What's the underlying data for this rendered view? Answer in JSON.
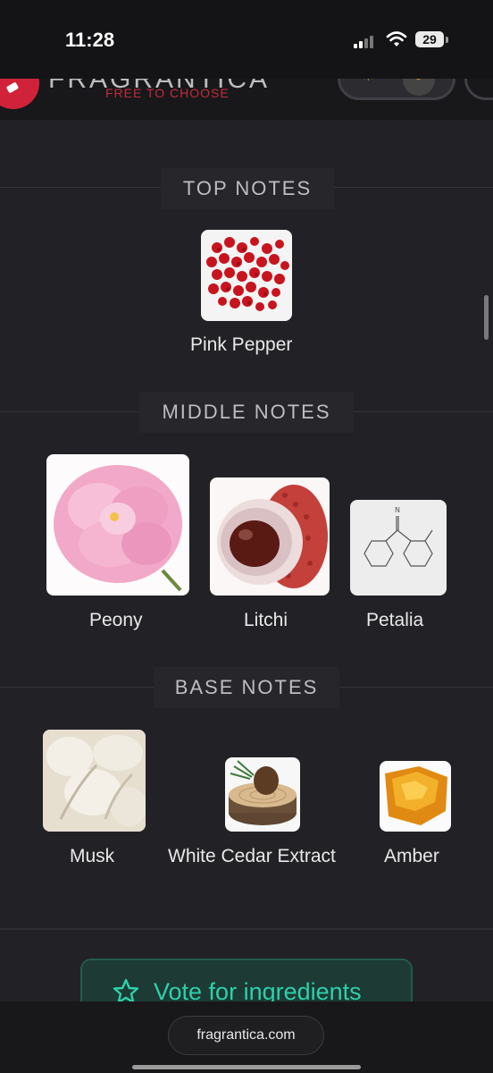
{
  "status_bar": {
    "time": "11:28",
    "battery": "29"
  },
  "header": {
    "brand": "FRAGRANTICA",
    "tagline": "FREE TO CHOOSE"
  },
  "sections": {
    "top": {
      "title": "TOP NOTES",
      "notes": [
        {
          "label": "Pink Pepper",
          "icon": "pink-pepper-image"
        }
      ]
    },
    "middle": {
      "title": "MIDDLE NOTES",
      "notes": [
        {
          "label": "Peony",
          "icon": "peony-image"
        },
        {
          "label": "Litchi",
          "icon": "litchi-image"
        },
        {
          "label": "Petalia",
          "icon": "petalia-molecule-image"
        }
      ]
    },
    "base": {
      "title": "BASE NOTES",
      "notes": [
        {
          "label": "Musk",
          "icon": "musk-image"
        },
        {
          "label": "White Cedar Extract",
          "icon": "white-cedar-image"
        },
        {
          "label": "Amber",
          "icon": "amber-image"
        }
      ]
    }
  },
  "vote_button": {
    "label": "Vote for ingredients",
    "icon": "star-icon"
  },
  "browser": {
    "url": "fragrantica.com"
  },
  "colors": {
    "accent": "#2ed0aa",
    "brand_red": "#c42a3c",
    "background": "#222226"
  }
}
